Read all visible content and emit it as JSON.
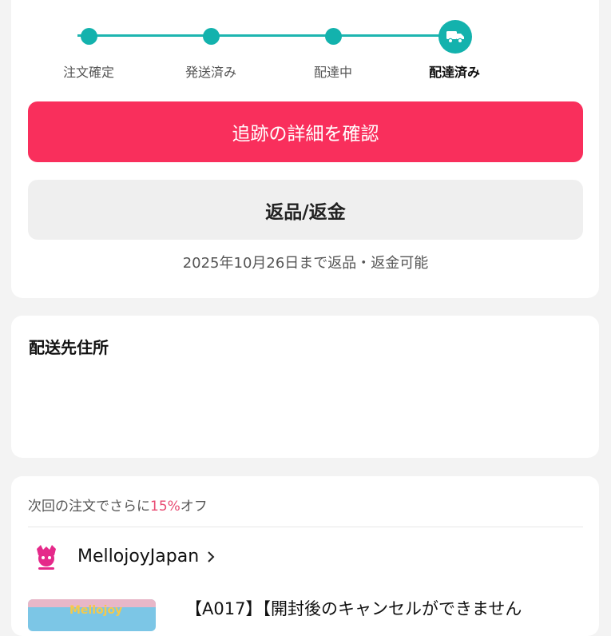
{
  "stepper": {
    "steps": [
      "注文確定",
      "発送済み",
      "配達中",
      "配達済み"
    ],
    "active_step_icon": "truck-icon",
    "accent_color": "#13b2ad"
  },
  "actions": {
    "track_label": "追跡の詳細を確認",
    "track_color": "#f92f5c",
    "return_label": "返品/返金",
    "return_deadline": "2025年10月26日まで返品・返金可能"
  },
  "address": {
    "title": "配送先住所"
  },
  "shop_section": {
    "promo_prefix": "次回の注文でさらに",
    "promo_percent": "15%",
    "promo_suffix": "オフ",
    "shop_name": "MellojoyJapan",
    "shop_logo_icon": "mellojoy-logo-icon",
    "product_title": "【A017】【開封後のキャンセルができません",
    "product_thumb_label": "Mellojoy"
  }
}
